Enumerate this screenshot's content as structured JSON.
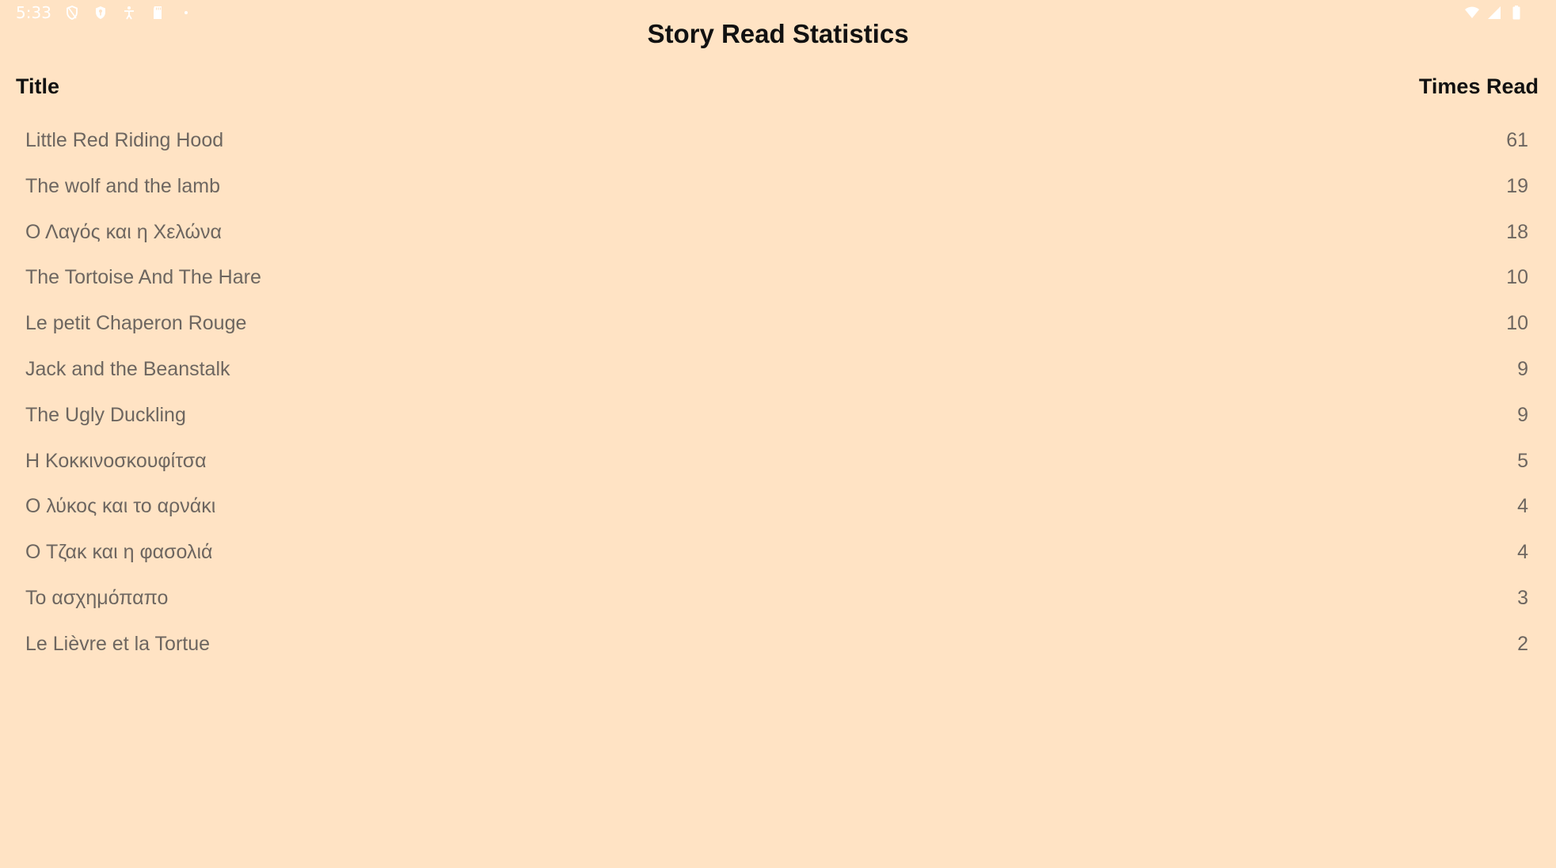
{
  "status_bar": {
    "time": "5:33",
    "icons_left": [
      "shield-outline-icon",
      "shield-filled-icon",
      "accessibility-icon",
      "sd-card-icon",
      "dot-icon"
    ],
    "icons_right": [
      "wifi-icon",
      "cellular-signal-icon",
      "battery-icon"
    ]
  },
  "page": {
    "title": "Story Read Statistics"
  },
  "table": {
    "headers": {
      "title": "Title",
      "times_read": "Times Read"
    },
    "rows": [
      {
        "title": "Little Red Riding Hood",
        "times_read": "61"
      },
      {
        "title": "The wolf and the lamb",
        "times_read": "19"
      },
      {
        "title": "Ο Λαγός και η Χελώνα",
        "times_read": "18"
      },
      {
        "title": "The Tortoise And The Hare",
        "times_read": "10"
      },
      {
        "title": "Le petit Chaperon Rouge",
        "times_read": "10"
      },
      {
        "title": "Jack and the Beanstalk",
        "times_read": "9"
      },
      {
        "title": "The Ugly Duckling",
        "times_read": "9"
      },
      {
        "title": "Η Κοκκινοσκουφίτσα",
        "times_read": "5"
      },
      {
        "title": "Ο λύκος και το αρνάκι",
        "times_read": "4"
      },
      {
        "title": "Ο Τζακ και η φασολιά",
        "times_read": "4"
      },
      {
        "title": "Το ασχημόπαπο",
        "times_read": "3"
      },
      {
        "title": "Le Lièvre et la Tortue",
        "times_read": "2"
      }
    ]
  },
  "colors": {
    "background": "#FFE3C4",
    "header_text": "#111111",
    "row_text": "#6d6660",
    "status_icons": "#ffffff"
  }
}
